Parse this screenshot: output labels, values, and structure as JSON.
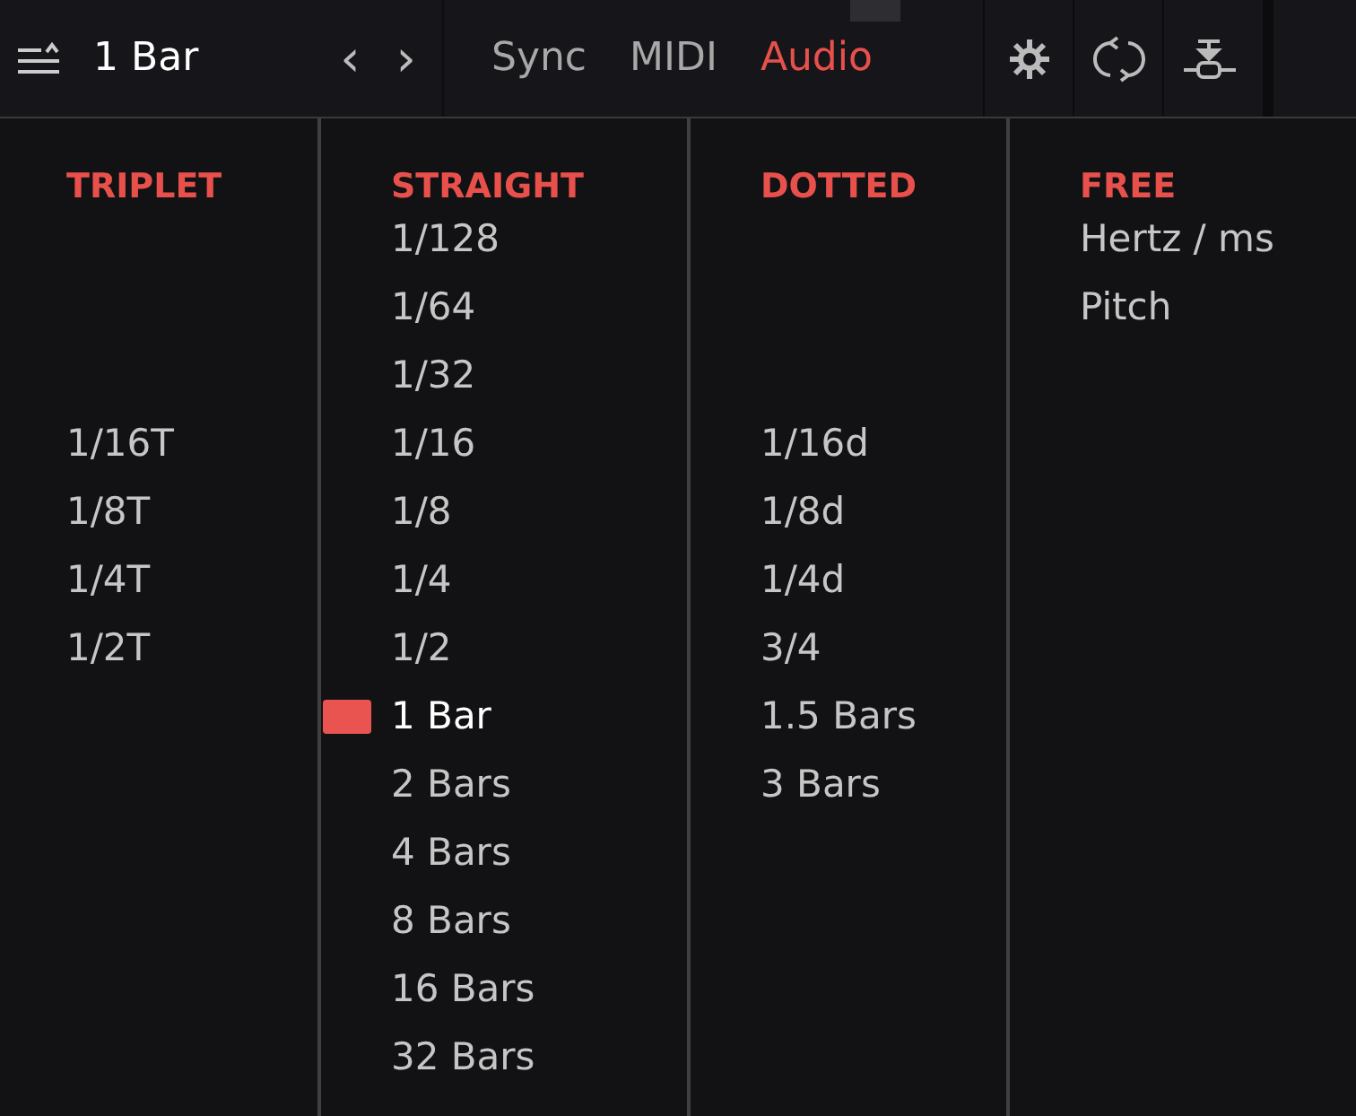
{
  "toolbar": {
    "value": "1 Bar",
    "prev": "‹",
    "next": "›",
    "tabs": [
      {
        "label": "Sync",
        "selected": false
      },
      {
        "label": "MIDI",
        "selected": false
      },
      {
        "label": "Audio",
        "selected": true
      }
    ]
  },
  "columns": [
    {
      "heading": "TRIPLET",
      "items": [
        {
          "kind": "blank"
        },
        {
          "kind": "blank"
        },
        {
          "kind": "blank"
        },
        {
          "kind": "option",
          "label": "1/16T",
          "selected": false
        },
        {
          "kind": "option",
          "label": "1/8T",
          "selected": false
        },
        {
          "kind": "option",
          "label": "1/4T",
          "selected": false
        },
        {
          "kind": "option",
          "label": "1/2T",
          "selected": false
        }
      ]
    },
    {
      "heading": "STRAIGHT",
      "items": [
        {
          "kind": "option",
          "label": "1/128",
          "selected": false
        },
        {
          "kind": "option",
          "label": "1/64",
          "selected": false
        },
        {
          "kind": "option",
          "label": "1/32",
          "selected": false
        },
        {
          "kind": "option",
          "label": "1/16",
          "selected": false
        },
        {
          "kind": "option",
          "label": "1/8",
          "selected": false
        },
        {
          "kind": "option",
          "label": "1/4",
          "selected": false
        },
        {
          "kind": "option",
          "label": "1/2",
          "selected": false
        },
        {
          "kind": "option",
          "label": "1 Bar",
          "selected": true
        },
        {
          "kind": "option",
          "label": "2 Bars",
          "selected": false
        },
        {
          "kind": "option",
          "label": "4 Bars",
          "selected": false
        },
        {
          "kind": "option",
          "label": "8 Bars",
          "selected": false
        },
        {
          "kind": "option",
          "label": "16 Bars",
          "selected": false
        },
        {
          "kind": "option",
          "label": "32 Bars",
          "selected": false
        }
      ]
    },
    {
      "heading": "DOTTED",
      "items": [
        {
          "kind": "blank"
        },
        {
          "kind": "blank"
        },
        {
          "kind": "blank"
        },
        {
          "kind": "option",
          "label": "1/16d",
          "selected": false
        },
        {
          "kind": "option",
          "label": "1/8d",
          "selected": false
        },
        {
          "kind": "option",
          "label": "1/4d",
          "selected": false
        },
        {
          "kind": "option",
          "label": "3/4",
          "selected": false
        },
        {
          "kind": "option",
          "label": "1.5 Bars",
          "selected": false
        },
        {
          "kind": "option",
          "label": "3 Bars",
          "selected": false
        }
      ]
    },
    {
      "heading": "FREE",
      "items": [
        {
          "kind": "option",
          "label": "Hertz / ms",
          "selected": false
        },
        {
          "kind": "option",
          "label": "Pitch",
          "selected": false
        }
      ]
    }
  ]
}
